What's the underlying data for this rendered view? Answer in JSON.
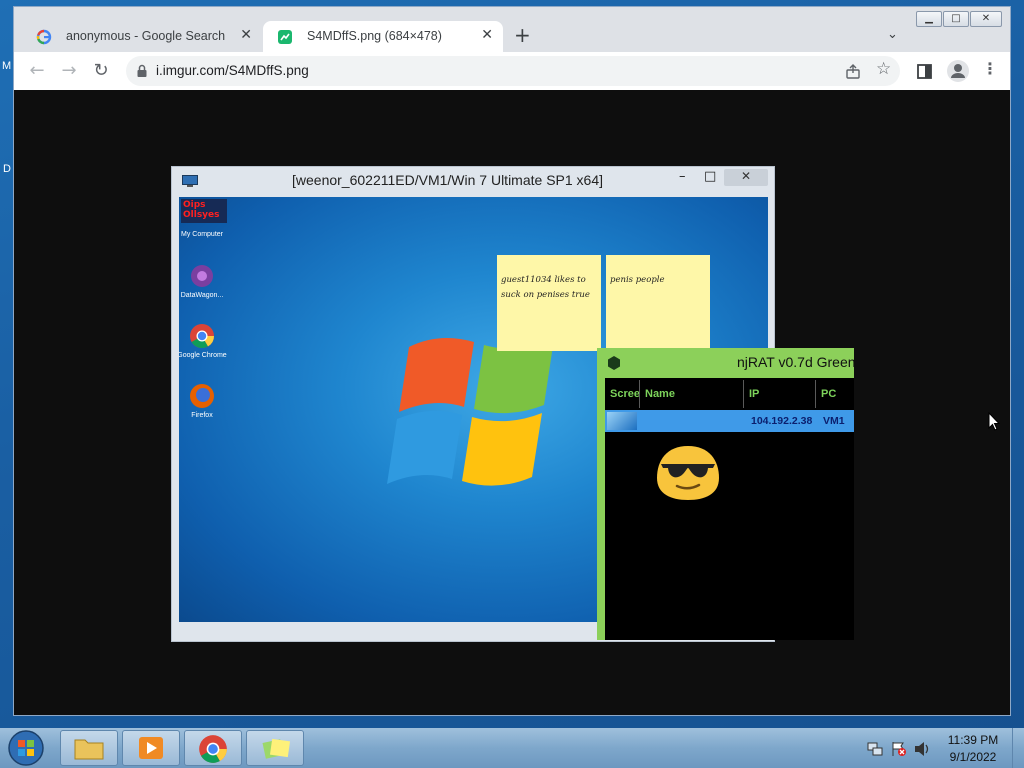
{
  "desktop": {
    "edge_fragments": [
      "M",
      "D"
    ]
  },
  "browser": {
    "tabs": [
      {
        "label": "anonymous - Google Search",
        "icon": "google-icon"
      },
      {
        "label": "S4MDffS.png (684×478)",
        "icon": "imgur-icon"
      }
    ],
    "new_tab_label": "+",
    "url": "i.imgur.com/S4MDffS.png",
    "window_controls": {
      "minimize": "▁",
      "maximize": "□",
      "close": "✕"
    }
  },
  "vm_window": {
    "title": "[weenor_602211ED/VM1/Win 7 Ultimate SP1 x64]",
    "desktop_icons": [
      {
        "label": "My Computer",
        "overlay": "Oips Ollsyes"
      },
      {
        "label": "DataWagon..."
      },
      {
        "label": "Google Chrome"
      },
      {
        "label": "Firefox"
      }
    ],
    "sticky_notes": [
      {
        "lines": [
          "guest11034 likes to",
          "suck on penises true"
        ]
      },
      {
        "lines": [
          "penis people"
        ]
      }
    ]
  },
  "njrat": {
    "title": "njRAT v0.7d Green",
    "columns": [
      "Scree",
      "Name",
      "IP",
      "PC"
    ],
    "row": {
      "name": "",
      "ip": "104.192.2.38",
      "pc": "VM1"
    }
  },
  "taskbar": {
    "time": "11:39 PM",
    "date": "9/1/2022"
  },
  "colors": {
    "chrome_frame": "#dee1e6",
    "rat_accent": "#8cd05a",
    "rat_row": "#3f9ae8",
    "taskbar": "#7ea7cb"
  }
}
